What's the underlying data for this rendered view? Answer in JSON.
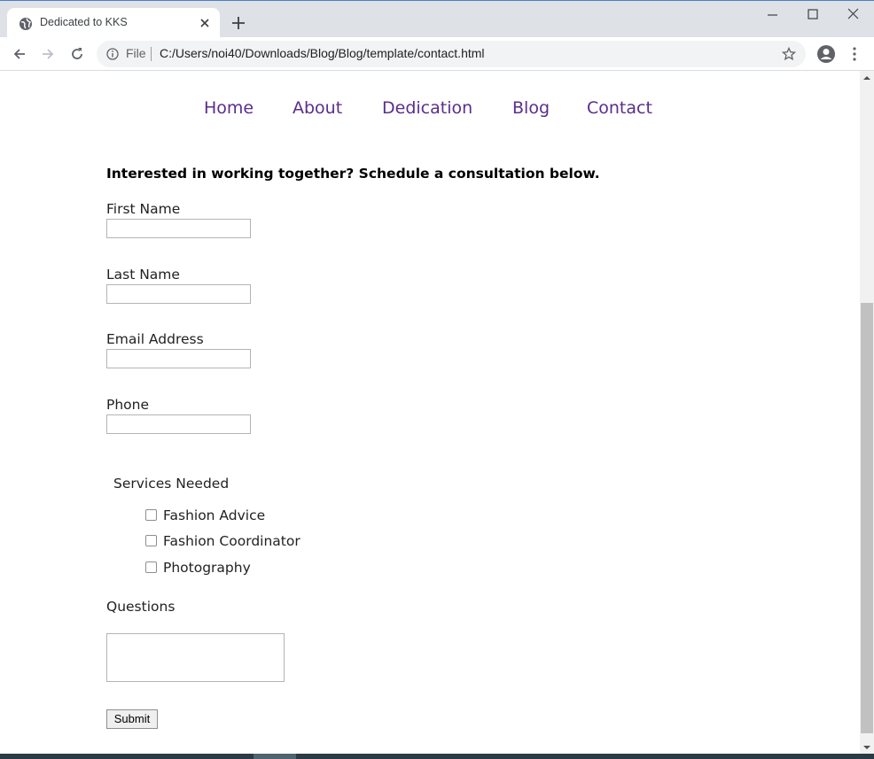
{
  "browser": {
    "tab_title": "Dedicated to KKS",
    "omnibox_scheme_label": "File",
    "url": "C:/Users/noi40/Downloads/Blog/Blog/template/contact.html"
  },
  "nav": {
    "items": [
      "Home",
      "About",
      "Dedication",
      "Blog",
      "Contact"
    ],
    "color": "#5a2d8c"
  },
  "form": {
    "intro": "Interested in working together? Schedule a consultation below.",
    "first_name_label": "First Name",
    "first_name_value": "",
    "last_name_label": "Last Name",
    "last_name_value": "",
    "email_label": "Email Address",
    "email_value": "",
    "phone_label": "Phone",
    "phone_value": "",
    "services_legend": "Services Needed",
    "services": [
      {
        "label": "Fashion Advice",
        "checked": false
      },
      {
        "label": "Fashion Coordinator",
        "checked": false
      },
      {
        "label": "Photography",
        "checked": false
      }
    ],
    "questions_label": "Questions",
    "questions_value": "",
    "submit_label": "Submit"
  }
}
